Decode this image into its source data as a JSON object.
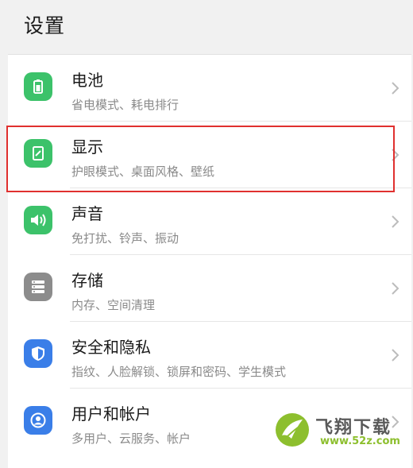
{
  "header": {
    "title": "设置"
  },
  "items": [
    {
      "title": "电池",
      "subtitle": "省电模式、耗电排行",
      "icon": "battery-icon",
      "color": "#3cc26a"
    },
    {
      "title": "显示",
      "subtitle": "护眼模式、桌面风格、壁纸",
      "icon": "display-icon",
      "color": "#3cc26a"
    },
    {
      "title": "声音",
      "subtitle": "免打扰、铃声、振动",
      "icon": "speaker-icon",
      "color": "#3cc26a"
    },
    {
      "title": "存储",
      "subtitle": "内存、空间清理",
      "icon": "storage-icon",
      "color": "#8c8c8c"
    },
    {
      "title": "安全和隐私",
      "subtitle": "指纹、人脸解锁、锁屏和密码、学生模式",
      "icon": "shield-icon",
      "color": "#3a7ee8"
    },
    {
      "title": "用户和帐户",
      "subtitle": "多用户、云服务、帐户",
      "icon": "user-icon",
      "color": "#3a7ee8"
    }
  ],
  "watermark": {
    "name": "飞翔下载",
    "url": "www.52z.com"
  }
}
